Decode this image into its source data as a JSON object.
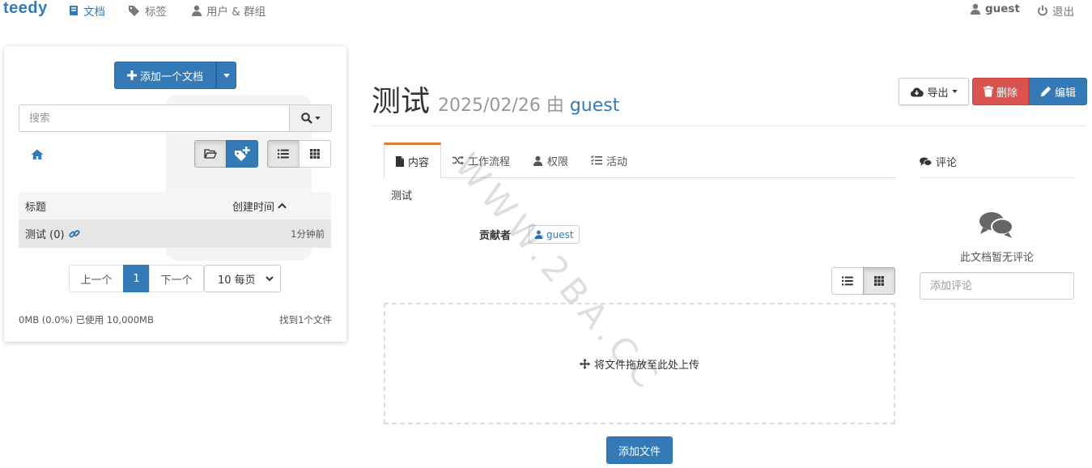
{
  "nav": {
    "brand": "teedy",
    "items": [
      {
        "label": "文档",
        "icon": "book-icon",
        "active": true
      },
      {
        "label": "标签",
        "icon": "tags-icon"
      },
      {
        "label": "用户 & 群组",
        "icon": "user-icon"
      }
    ],
    "user": "guest",
    "logout": "退出"
  },
  "sidebar": {
    "add_document": "添加一个文档",
    "search_placeholder": "搜索",
    "table": {
      "col_title": "标题",
      "col_created": "创建时间",
      "rows": [
        {
          "title": "测试 (0)",
          "age": "1分钟前"
        }
      ]
    },
    "pager": {
      "prev": "上一个",
      "page": "1",
      "next": "下一个",
      "per_page": "10 每页"
    },
    "usage": "0MB (0.0%) 已使用 10,000MB",
    "found": "找到1个文件"
  },
  "document": {
    "title": "测试",
    "date": "2025/02/26",
    "by": "由",
    "author": "guest",
    "export": "导出",
    "delete": "删除",
    "edit": "编辑",
    "tabs": [
      {
        "label": "内容",
        "icon": "file-icon",
        "active": true
      },
      {
        "label": "工作流程",
        "icon": "shuffle-icon"
      },
      {
        "label": "权限",
        "icon": "user-icon"
      },
      {
        "label": "活动",
        "icon": "list-check-icon"
      }
    ],
    "content": "测试",
    "contributors_label": "贡献者",
    "contributor": "guest",
    "drop_text": "将文件拖放至此处上传",
    "add_file": "添加文件"
  },
  "comments": {
    "title": "评论",
    "empty": "此文档暂无评论",
    "placeholder": "添加评论"
  },
  "watermark": "WWW.2BA.CC",
  "colors": {
    "primary": "#337ab7",
    "danger": "#d9534f",
    "tab_accent": "#e07b39"
  }
}
